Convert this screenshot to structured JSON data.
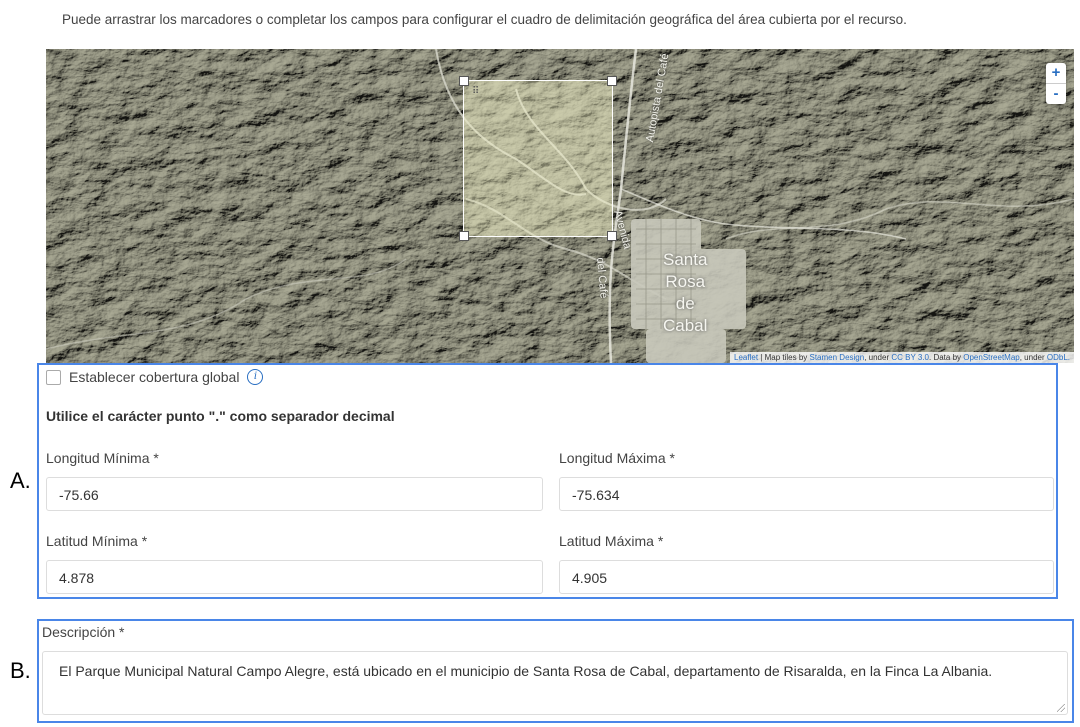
{
  "intro_text": "Puede arrastrar los marcadores o completar los campos para configurar el cuadro de delimitación geográfica del área cubierta por el recurso.",
  "map": {
    "zoom_in": "+",
    "zoom_out": "-",
    "city_lines": [
      "Santa",
      "Rosa",
      "de",
      "Cabal"
    ],
    "road_labels": [
      "Autopista del Café",
      "Avenida",
      "del Café"
    ],
    "attribution": {
      "leaflet": "Leaflet",
      "text1": " | Map tiles by ",
      "stamen": "Stamen Design",
      "text2": ", under ",
      "ccby": "CC BY 3.0",
      "text3": ". Data by ",
      "osm": "OpenStreetMap",
      "text4": ", under ",
      "odbl": "ODbL."
    }
  },
  "labels": {
    "a": "A.",
    "b": "B."
  },
  "global_coverage": {
    "label": "Establecer cobertura global",
    "info_icon": "i"
  },
  "decimal_note": "Utilice el carácter punto \".\" como separador decimal",
  "fields": {
    "lon_min": {
      "label": "Longitud Mínima *",
      "value": "-75.66"
    },
    "lon_max": {
      "label": "Longitud Máxima *",
      "value": "-75.634"
    },
    "lat_min": {
      "label": "Latitud Mínima *",
      "value": "4.878"
    },
    "lat_max": {
      "label": "Latitud Máxima *",
      "value": "4.905"
    }
  },
  "description": {
    "label": "Descripción *",
    "value": "El Parque Municipal Natural Campo Alegre, está ubicado en el municipio de Santa Rosa de Cabal, departamento de Risaralda, en la Finca La Albania."
  },
  "colors": {
    "accent": "#4a86e8",
    "link": "#2a6fc2"
  }
}
